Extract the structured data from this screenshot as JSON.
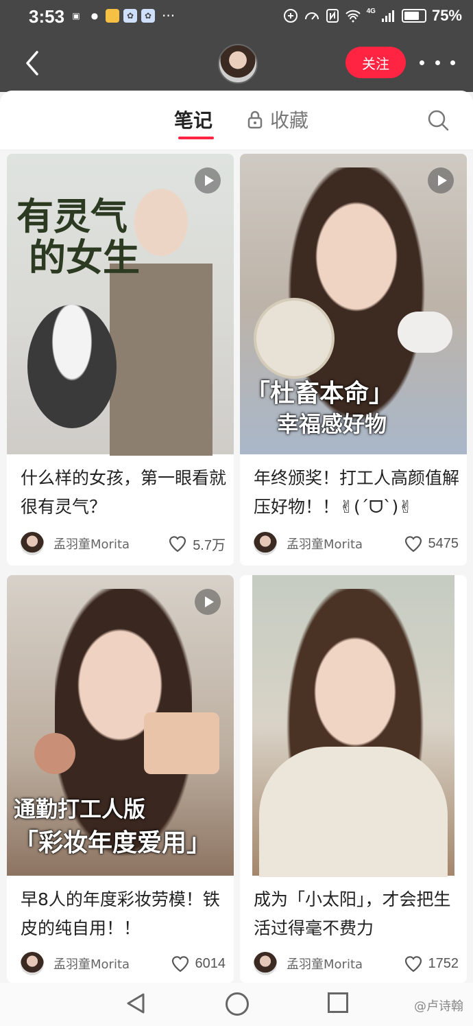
{
  "status_bar": {
    "time": "3:53",
    "battery": "75%",
    "battery_level": 0.75,
    "network": "4G",
    "icons": [
      "bilibili-icon",
      "wechat-icon",
      "app-icon",
      "baidu-icon",
      "baidu-icon"
    ],
    "more": "···"
  },
  "header": {
    "follow_label": "关注"
  },
  "tabs": {
    "notes": "笔记",
    "collections": "收藏"
  },
  "cards": [
    {
      "title": "什么样的女孩，第一眼看就很有灵气？",
      "author": "孟羽童Morita",
      "likes": "5.7万",
      "overlay": [
        "有灵气",
        "的女生"
      ],
      "is_video": true
    },
    {
      "title": "年终颁奖！打工人高颜值解压好物！！✌(ˊᗜˋ)✌",
      "author": "孟羽童Morita",
      "likes": "5475",
      "overlay": [
        "「杜畜本命」",
        "幸福感好物"
      ],
      "is_video": true
    },
    {
      "title": "早8人的年度彩妆劳模！铁皮的纯自用！！",
      "author": "孟羽童Morita",
      "likes": "6014",
      "overlay": [
        "通勤打工人版",
        "「彩妆年度爱用」"
      ],
      "is_video": true
    },
    {
      "title": "成为「小太阳」，才会把生活过得毫不费力",
      "author": "孟羽童Morita",
      "likes": "1752",
      "overlay": [],
      "is_video": false
    }
  ],
  "watermark": "@卢诗翰",
  "colors": {
    "accent": "#ff2442",
    "header_bg": "#474747"
  }
}
